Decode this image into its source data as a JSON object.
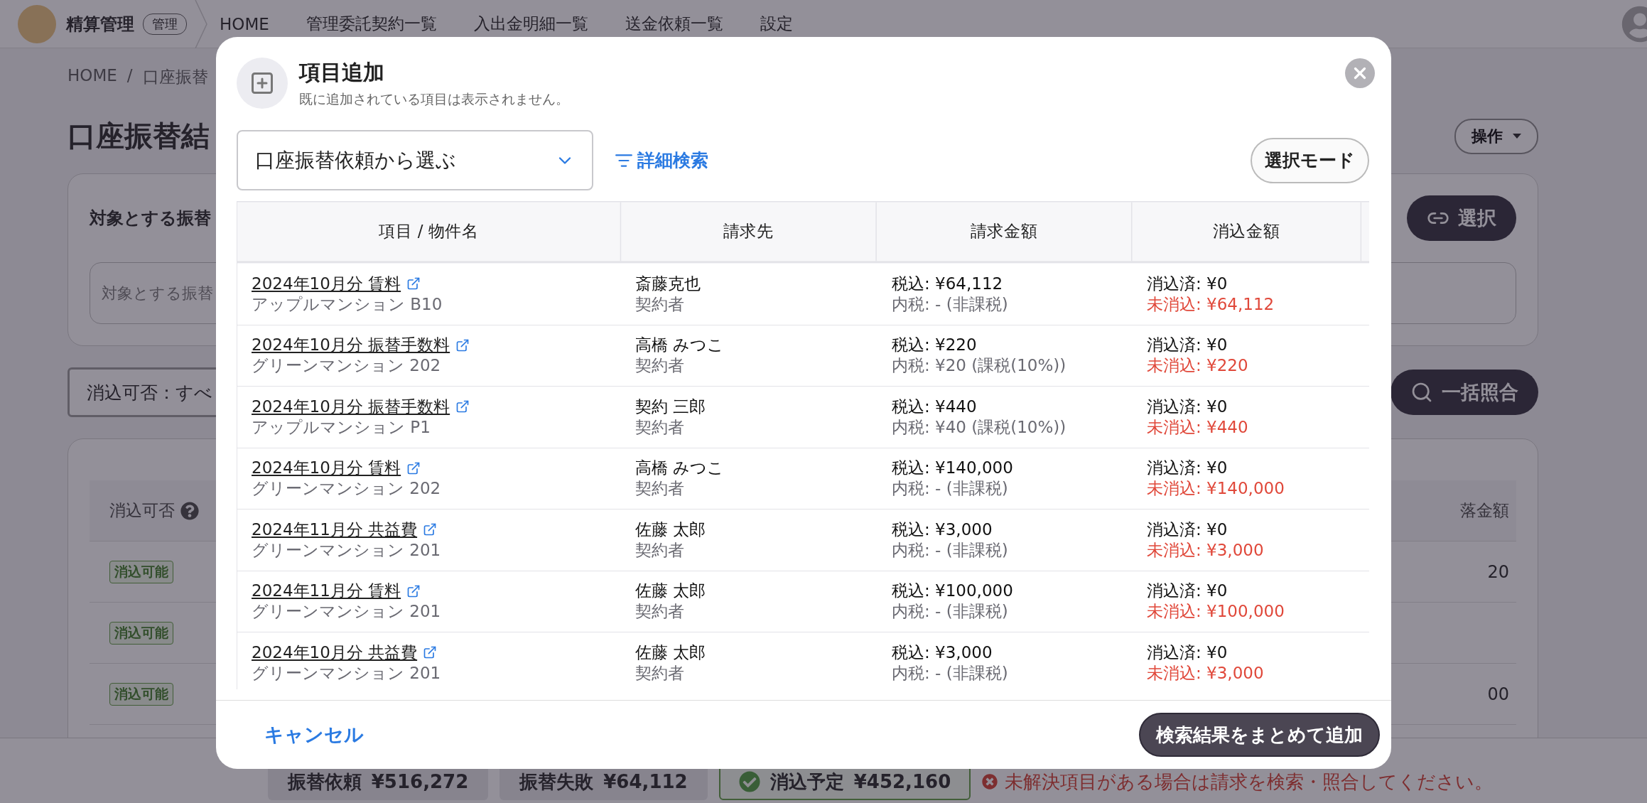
{
  "app": {
    "title": "精算管理",
    "role_badge": "管理"
  },
  "nav": [
    {
      "label": "HOME"
    },
    {
      "label": "管理委託契約一覧"
    },
    {
      "label": "入出金明細一覧"
    },
    {
      "label": "送金依頼一覧"
    },
    {
      "label": "設定"
    }
  ],
  "page": {
    "breadcrumb": [
      "HOME",
      "口座振替"
    ],
    "breadcrumb_separator": "/",
    "title": "口座振替結",
    "actions_button": "操作",
    "target_card": {
      "title": "対象とする振替",
      "select_button": "選択",
      "placeholder": "対象とする振替"
    },
    "filter": {
      "value": "消込可否：すべ"
    },
    "bulk_button": "一括照合",
    "table": {
      "columns": [
        "消込可否",
        "落金額"
      ],
      "rows": [
        {
          "status": "消込可能",
          "amount": "20"
        },
        {
          "status": "消込可能"
        },
        {
          "status": "消込可能",
          "amount": "00"
        }
      ]
    }
  },
  "summary": [
    {
      "kind": "plain",
      "label": "振替依頼",
      "amount": "¥516,272"
    },
    {
      "kind": "plain",
      "label": "振替失敗",
      "amount": "¥64,112"
    },
    {
      "kind": "ok",
      "label": "消込予定",
      "amount": "¥452,160"
    }
  ],
  "warning": "未解決項目がある場合は請求を検索・照合してください。",
  "modal": {
    "title": "項目追加",
    "subtitle": "既に追加されている項目は表示されません。",
    "source_select": "口座振替依頼から選ぶ",
    "advanced_search": "詳細検索",
    "select_mode_button": "選択モード",
    "columns": [
      "項目 / 物件名",
      "請求先",
      "請求金額",
      "消込金額"
    ],
    "rows": [
      {
        "item": "2024年10月分 賃料",
        "property": "アップルマンション B10",
        "payer": "斎藤克也",
        "payer_role": "契約者",
        "billed": "税込: ¥64,112",
        "tax": "内税: - (非課税)",
        "cleared": "消込済: ¥0",
        "uncleared": "未消込: ¥64,112"
      },
      {
        "item": "2024年10月分 振替手数料",
        "property": "グリーンマンション 202",
        "payer": "高橋 みつこ",
        "payer_role": "契約者",
        "billed": "税込: ¥220",
        "tax": "内税: ¥20 (課税(10%))",
        "cleared": "消込済: ¥0",
        "uncleared": "未消込: ¥220"
      },
      {
        "item": "2024年10月分 振替手数料",
        "property": "アップルマンション P1",
        "payer": "契約 三郎",
        "payer_role": "契約者",
        "billed": "税込: ¥440",
        "tax": "内税: ¥40 (課税(10%))",
        "cleared": "消込済: ¥0",
        "uncleared": "未消込: ¥440"
      },
      {
        "item": "2024年10月分 賃料",
        "property": "グリーンマンション 202",
        "payer": "高橋 みつこ",
        "payer_role": "契約者",
        "billed": "税込: ¥140,000",
        "tax": "内税: - (非課税)",
        "cleared": "消込済: ¥0",
        "uncleared": "未消込: ¥140,000"
      },
      {
        "item": "2024年11月分 共益費",
        "property": "グリーンマンション 201",
        "payer": "佐藤 太郎",
        "payer_role": "契約者",
        "billed": "税込: ¥3,000",
        "tax": "内税: - (非課税)",
        "cleared": "消込済: ¥0",
        "uncleared": "未消込: ¥3,000"
      },
      {
        "item": "2024年11月分 賃料",
        "property": "グリーンマンション 201",
        "payer": "佐藤 太郎",
        "payer_role": "契約者",
        "billed": "税込: ¥100,000",
        "tax": "内税: - (非課税)",
        "cleared": "消込済: ¥0",
        "uncleared": "未消込: ¥100,000"
      },
      {
        "item": "2024年10月分 共益費",
        "property": "グリーンマンション 201",
        "payer": "佐藤 太郎",
        "payer_role": "契約者",
        "billed": "税込: ¥3,000",
        "tax": "内税: - (非課税)",
        "cleared": "消込済: ¥0",
        "uncleared": "未消込: ¥3,000"
      }
    ],
    "cancel_button": "キャンセル",
    "add_all_button": "検索結果をまとめて追加"
  }
}
